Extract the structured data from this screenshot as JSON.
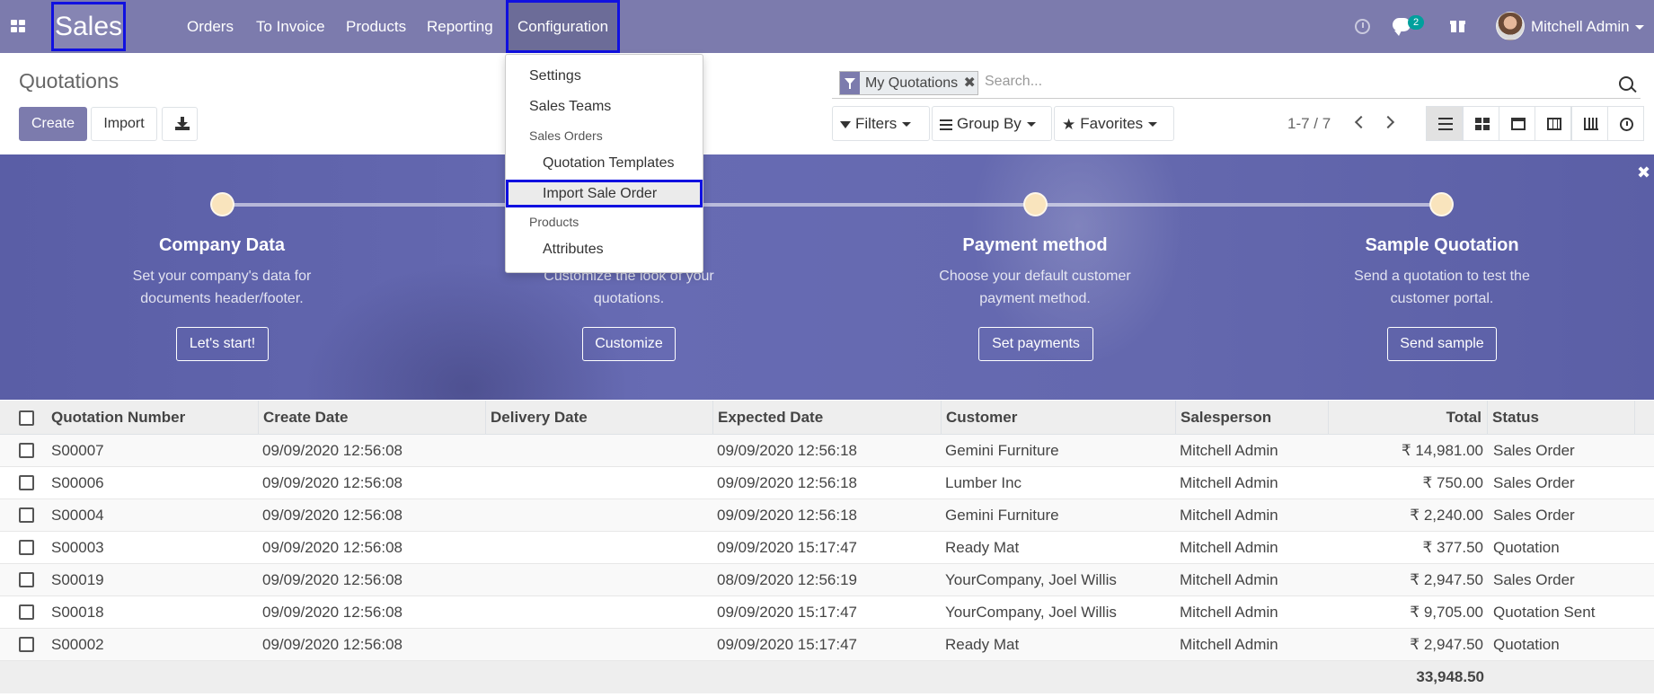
{
  "navbar": {
    "brand": "Sales",
    "menu": [
      "Orders",
      "To Invoice",
      "Products",
      "Reporting",
      "Configuration"
    ],
    "active_menu": "Configuration",
    "chat_badge": "2",
    "user_name": "Mitchell Admin"
  },
  "dropdown": {
    "items": {
      "settings": "Settings",
      "sales_teams": "Sales Teams",
      "sales_orders_header": "Sales Orders",
      "quotation_templates": "Quotation Templates",
      "import_sale_order": "Import Sale Order",
      "products_header": "Products",
      "attributes": "Attributes"
    }
  },
  "control_panel": {
    "title": "Quotations",
    "create_label": "Create",
    "import_label": "Import",
    "search_facet": "My Quotations",
    "search_placeholder": "Search...",
    "filters_label": "Filters",
    "groupby_label": "Group By",
    "favorites_label": "Favorites",
    "pager": "1-7 / 7"
  },
  "banner": {
    "steps": [
      {
        "title": "Company Data",
        "desc": "Set your company's data for documents header/footer.",
        "button": "Let's start!"
      },
      {
        "title": "",
        "desc": "Customize the look of your quotations.",
        "button": "Customize"
      },
      {
        "title": "Payment method",
        "desc": "Choose your default customer payment method.",
        "button": "Set payments"
      },
      {
        "title": "Sample Quotation",
        "desc": "Send a quotation to test the customer portal.",
        "button": "Send sample"
      }
    ]
  },
  "table": {
    "headers": [
      "Quotation Number",
      "Create Date",
      "Delivery Date",
      "Expected Date",
      "Customer",
      "Salesperson",
      "Total",
      "Status"
    ],
    "rows": [
      [
        "S00007",
        "09/09/2020 12:56:08",
        "",
        "09/09/2020 12:56:18",
        "Gemini Furniture",
        "Mitchell Admin",
        "₹ 14,981.00",
        "Sales Order"
      ],
      [
        "S00006",
        "09/09/2020 12:56:08",
        "",
        "09/09/2020 12:56:18",
        "Lumber Inc",
        "Mitchell Admin",
        "₹ 750.00",
        "Sales Order"
      ],
      [
        "S00004",
        "09/09/2020 12:56:08",
        "",
        "09/09/2020 12:56:18",
        "Gemini Furniture",
        "Mitchell Admin",
        "₹ 2,240.00",
        "Sales Order"
      ],
      [
        "S00003",
        "09/09/2020 12:56:08",
        "",
        "09/09/2020 15:17:47",
        "Ready Mat",
        "Mitchell Admin",
        "₹ 377.50",
        "Quotation"
      ],
      [
        "S00019",
        "09/09/2020 12:56:08",
        "",
        "08/09/2020 12:56:19",
        "YourCompany, Joel Willis",
        "Mitchell Admin",
        "₹ 2,947.50",
        "Sales Order"
      ],
      [
        "S00018",
        "09/09/2020 12:56:08",
        "",
        "09/09/2020 15:17:47",
        "YourCompany, Joel Willis",
        "Mitchell Admin",
        "₹ 9,705.00",
        "Quotation Sent"
      ],
      [
        "S00002",
        "09/09/2020 12:56:08",
        "",
        "09/09/2020 15:17:47",
        "Ready Mat",
        "Mitchell Admin",
        "₹ 2,947.50",
        "Quotation"
      ]
    ],
    "total": "33,948.50"
  },
  "colors": {
    "brand": "#7c7bad",
    "highlight_border": "#1010e0",
    "badge": "#00a09d"
  }
}
